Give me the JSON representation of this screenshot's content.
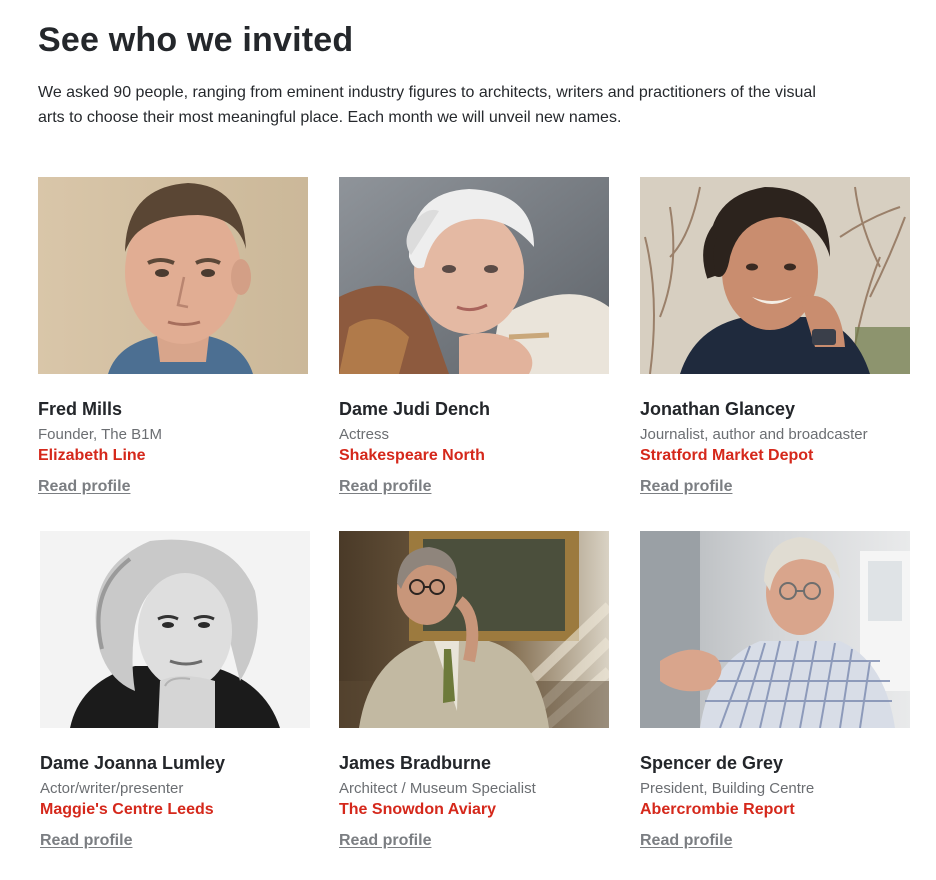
{
  "heading": "See who we invited",
  "intro": "We asked 90 people, ranging from eminent industry figures to architects, writers and practitioners of the visual arts to choose their most meaningful place. Each month we will unveil new names.",
  "link_label": "Read profile",
  "accent_color": "#d5281b",
  "people": [
    {
      "name": "Fred Mills",
      "role": "Founder, The B1M",
      "place": "Elizabeth Line"
    },
    {
      "name": "Dame Judi Dench",
      "role": "Actress",
      "place": "Shakespeare North"
    },
    {
      "name": "Jonathan Glancey",
      "role": "Journalist, author and broadcaster",
      "place": "Stratford Market Depot"
    },
    {
      "name": "Dame Joanna Lumley",
      "role": "Actor/writer/presenter",
      "place": "Maggie's Centre Leeds"
    },
    {
      "name": "James Bradburne",
      "role": "Architect / Museum Specialist",
      "place": "The Snowdon Aviary"
    },
    {
      "name": "Spencer de Grey",
      "role": "President, Building Centre",
      "place": "Abercrombie Report"
    }
  ]
}
